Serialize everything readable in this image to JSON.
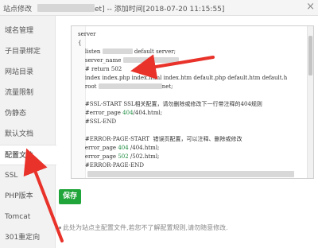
{
  "window": {
    "title_prefix": "站点修改",
    "title_suffix": "et] -- 添加时间[2018-07-20 11:15:55]",
    "close_glyph": "×"
  },
  "sidebar": {
    "items": [
      {
        "label": "域名管理"
      },
      {
        "label": "子目录绑定"
      },
      {
        "label": "网站目录"
      },
      {
        "label": "流量限制"
      },
      {
        "label": "伪静态"
      },
      {
        "label": "默认文档"
      },
      {
        "label": "配置文件",
        "active": true
      },
      {
        "label": "SSL"
      },
      {
        "label": "PHP版本"
      },
      {
        "label": "Tomcat"
      },
      {
        "label": "301重定向"
      }
    ]
  },
  "editor": {
    "lines": {
      "l1": "server",
      "l2": "{",
      "l3a": "    listen ",
      "l3b": " default server;",
      "l4": "    server_name ",
      "l5a": "    # return 502",
      "l5b": "",
      "l6": "    index index.php index.html index.htm default.php default.htm default.h",
      "l7a": "    root ",
      "l7b": "net;",
      "l9": "    #SSL-START SSL相关配置，请勿删除或修改下一行带注释的404规则",
      "l10a": "    #error_page ",
      "l10b": "404",
      "l10c": "/404.html;",
      "l11": "    #SSL-END",
      "l13": "    #ERROR-PAGE-START  错误页配置，可以注释、删除或修改",
      "l14a": "    error_page ",
      "l14b": "404",
      "l14c": " /404.html;",
      "l15a": "    error_page ",
      "l15b": "502",
      "l15c": " /502.html;",
      "l16": "    #ERROR-PAGE-END"
    }
  },
  "save_button": {
    "label": "保存",
    "color": "#20a53a"
  },
  "hint_text": "此处为站点主配置文件,若您不了解配置规则,请勿随意修改.",
  "colors": {
    "accent": "#20a53a",
    "annotation": "#e8322a",
    "code_number": "#1a8b3c"
  }
}
